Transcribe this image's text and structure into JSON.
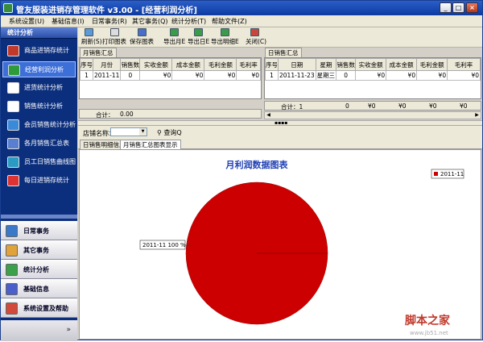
{
  "window": {
    "title": "管友服装进销存管理软件 v3.00 - [经营利润分析]"
  },
  "menu": [
    "系统设置(U)",
    "基础信息(I)",
    "日常事务(R)",
    "其它事务(Q)",
    "统计分析(T)",
    "帮助文件(Z)"
  ],
  "sidebar": {
    "header": "统计分析",
    "items": [
      "商品进销存统计",
      "经营利润分析",
      "进货统计分析",
      "销售统计分析",
      "会员销售统计分析",
      "各月销售汇总表",
      "员工日销售曲线图",
      "每日进销存统计"
    ],
    "selected": "经营利润分析",
    "categories": [
      "日常事务",
      "其它事务",
      "统计分析",
      "基础信息",
      "系统设置及帮助"
    ],
    "expand_glyph": "»"
  },
  "toolbar": {
    "refresh": "刷新(S)",
    "print_chart": "打印图表",
    "save_chart": "保存图表",
    "export_month": "导出月E",
    "export_day": "导出日E",
    "export_detail": "导出明细E",
    "close": "关闭(C)"
  },
  "monthly": {
    "tab": "月销售汇总",
    "columns": [
      "序号",
      "月份",
      "销售数",
      "实收金额",
      "成本金额",
      "毛利金额",
      "毛利率"
    ],
    "rows": [
      [
        "1",
        "2011-11",
        "0",
        "¥0",
        "¥0",
        "¥0",
        "¥0"
      ]
    ],
    "total_label": "合计：",
    "total_value": "0.00"
  },
  "daily": {
    "tab": "日销售汇总",
    "columns": [
      "序号",
      "日期",
      "星期",
      "销售数",
      "实收金额",
      "成本金额",
      "毛利金额",
      "毛利率"
    ],
    "rows": [
      [
        "1",
        "2011-11-23",
        "星期三",
        "0",
        "¥0",
        "¥0",
        "¥0",
        "¥0"
      ]
    ],
    "total_label": "合计：1",
    "totals": [
      "0",
      "¥0",
      "¥0",
      "¥0",
      "¥0"
    ]
  },
  "filter": {
    "shop_label": "店铺名称：",
    "shop_value": "",
    "query_label": "查询Q"
  },
  "tabs2": [
    "日销售明细信息",
    "月销售汇总图表显示"
  ],
  "tabs2_active": 1,
  "colors": {
    "pie": "#cc0000"
  },
  "chart_data": {
    "type": "pie",
    "title": "月利润数据图表",
    "categories": [
      "2011-11"
    ],
    "values": [
      100
    ],
    "slice_labels": [
      "2011-11 100 %"
    ],
    "legend": [
      "2011-11"
    ],
    "legend_position": "top-right"
  },
  "watermark": {
    "text": "脚本之家",
    "url": "www.jb51.net"
  }
}
